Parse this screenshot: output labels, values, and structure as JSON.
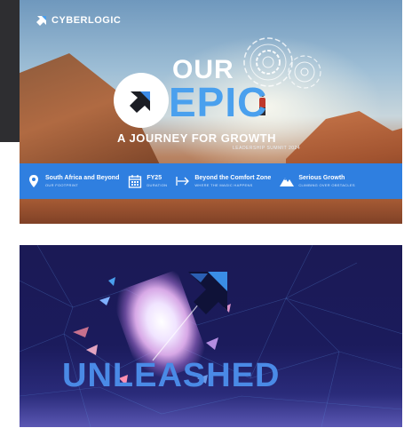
{
  "banner1": {
    "brand_name": "CYBERLOGIC",
    "headline_top": "OUR",
    "headline_main": "EPIC",
    "tagline": "A JOURNEY FOR GROWTH",
    "sub_tagline": "LEADERSHIP SUMMIT 2024",
    "info_items": [
      {
        "icon": "location-pin-icon",
        "title": "South Africa and Beyond",
        "sub": "OUR FOOTPRINT"
      },
      {
        "icon": "calendar-icon",
        "title": "FY25",
        "sub": "DURATION"
      },
      {
        "icon": "arrow-right-bar-icon",
        "title": "Beyond the Comfort Zone",
        "sub": "WHERE THE MAGIC HAPPENS"
      },
      {
        "icon": "mountain-icon",
        "title": "Serious Growth",
        "sub": "CLIMBING OVER OBSTACLES"
      }
    ],
    "colors": {
      "accent": "#2f7fe0",
      "epic": "#4aa0ee"
    }
  },
  "banner2": {
    "title": "UNLEASHED",
    "colors": {
      "background": "#1b1a55",
      "title": "#4a8ae6"
    }
  }
}
